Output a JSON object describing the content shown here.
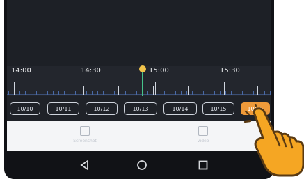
{
  "timeline": {
    "labels": [
      "14:00",
      "14:30",
      "15:00",
      "15:30"
    ]
  },
  "dates": [
    "10/10",
    "10/11",
    "10/12",
    "10/13",
    "10/14",
    "10/15",
    "10/16"
  ],
  "active_date_index": 6,
  "toolbar": {
    "left_label": "Screenshot",
    "right_label": "Video"
  },
  "icons": {
    "back": "back-triangle-icon",
    "home": "home-circle-icon",
    "recents": "recents-square-icon",
    "pointer": "tapping-hand-icon"
  },
  "colors": {
    "accent": "#ef9a3a",
    "playhead": "#46c48a",
    "playhead_marker": "#f0c34b"
  }
}
